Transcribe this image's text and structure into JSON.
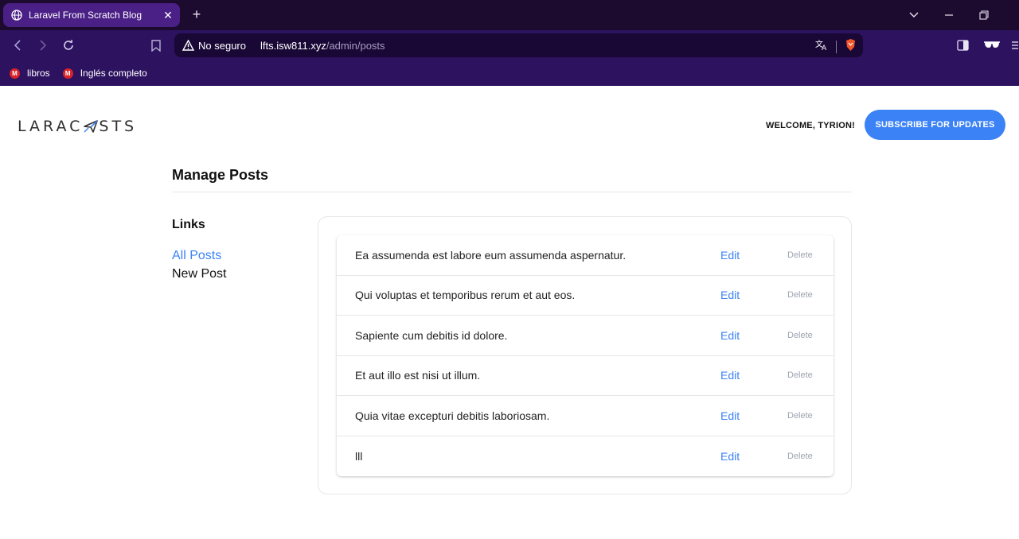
{
  "browser": {
    "tab_title": "Laravel From Scratch Blog",
    "tab_close": "✕",
    "new_tab": "+",
    "security_label": "No seguro",
    "url_host": "lfts.isw811.xyz",
    "url_path": "/admin/posts",
    "bookmarks": [
      {
        "label": "libros",
        "icon": "M"
      },
      {
        "label": "Inglés completo",
        "icon": "M"
      }
    ]
  },
  "header": {
    "logo_left": "LARAC",
    "logo_right": "STS",
    "welcome": "WELCOME, TYRION!",
    "subscribe": "SUBSCRIBE FOR UPDATES"
  },
  "main": {
    "heading": "Manage Posts",
    "sidebar": {
      "title": "Links",
      "links": [
        "All Posts",
        "New Post"
      ]
    },
    "posts": [
      {
        "title": "Ea assumenda est labore eum assumenda aspernatur.",
        "edit": "Edit",
        "delete": "Delete"
      },
      {
        "title": "Qui voluptas et temporibus rerum et aut eos.",
        "edit": "Edit",
        "delete": "Delete"
      },
      {
        "title": "Sapiente cum debitis id dolore.",
        "edit": "Edit",
        "delete": "Delete"
      },
      {
        "title": "Et aut illo est nisi ut illum.",
        "edit": "Edit",
        "delete": "Delete"
      },
      {
        "title": "Quia vitae excepturi debitis laboriosam.",
        "edit": "Edit",
        "delete": "Delete"
      },
      {
        "title": "lll",
        "edit": "Edit",
        "delete": "Delete"
      }
    ]
  },
  "colors": {
    "accent": "#3b82f6",
    "chrome_dark": "#1c0b2e",
    "chrome": "#2d1260",
    "active_tab": "#4a1f86"
  }
}
